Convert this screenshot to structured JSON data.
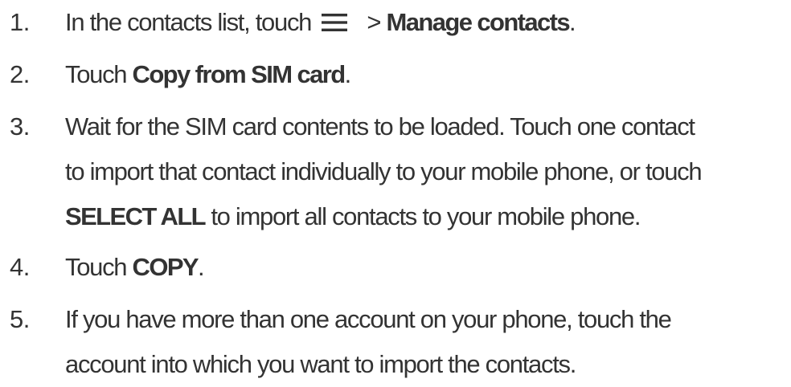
{
  "steps": [
    {
      "number": "1.",
      "pre": "In the contacts list, touch",
      "icon": "menu-icon",
      "mid": " > ",
      "bold": "Manage contacts",
      "post": "."
    },
    {
      "number": "2.",
      "pre": "Touch ",
      "bold": "Copy from SIM card",
      "post": "."
    },
    {
      "number": "3.",
      "line1": "Wait for the SIM card contents to be loaded. Touch one contact",
      "line2": "to import that contact individually to your mobile phone, or touch",
      "bold": "SELECT ALL",
      "line3_post": " to import all contacts to your mobile phone."
    },
    {
      "number": "4.",
      "pre": "Touch ",
      "bold": "COPY",
      "post": "."
    },
    {
      "number": "5.",
      "line1": "If you have more than one account on your phone, touch the",
      "line2": "account into which you want to import the contacts."
    }
  ],
  "colors": {
    "text": "#333333",
    "background": "#ffffff"
  }
}
